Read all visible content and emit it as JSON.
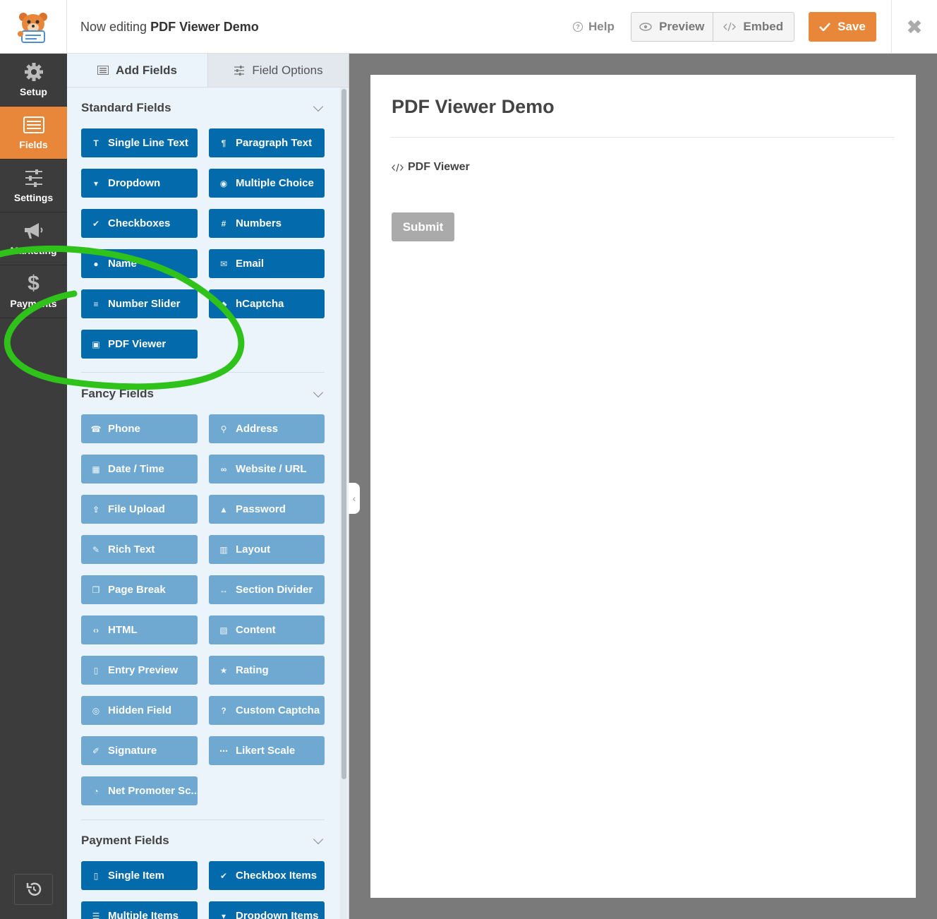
{
  "header": {
    "editing_prefix": "Now editing",
    "form_name": "PDF Viewer Demo",
    "help_label": "Help",
    "preview_label": "Preview",
    "embed_label": "Embed",
    "save_label": "Save",
    "accent_color": "#e8873a"
  },
  "sidebar": {
    "items": [
      {
        "label": "Setup",
        "icon": "gear-icon"
      },
      {
        "label": "Fields",
        "icon": "fields-list-icon",
        "active": true
      },
      {
        "label": "Settings",
        "icon": "sliders-icon"
      },
      {
        "label": "Marketing",
        "icon": "megaphone-icon"
      },
      {
        "label": "Payments",
        "icon": "dollar-icon"
      }
    ],
    "revisions_icon": "history-icon"
  },
  "panel": {
    "tabs": [
      {
        "label": "Add Fields",
        "icon": "list-icon",
        "active": true
      },
      {
        "label": "Field Options",
        "icon": "sliders-icon",
        "active": false
      }
    ],
    "standard": {
      "title": "Standard Fields",
      "fields": [
        {
          "label": "Single Line Text",
          "icon": "text-icon"
        },
        {
          "label": "Paragraph Text",
          "icon": "paragraph-icon"
        },
        {
          "label": "Dropdown",
          "icon": "dropdown-icon"
        },
        {
          "label": "Multiple Choice",
          "icon": "radio-icon"
        },
        {
          "label": "Checkboxes",
          "icon": "checkbox-icon"
        },
        {
          "label": "Numbers",
          "icon": "hash-icon"
        },
        {
          "label": "Name",
          "icon": "user-icon"
        },
        {
          "label": "Email",
          "icon": "envelope-icon"
        },
        {
          "label": "Number Slider",
          "icon": "slider-icon"
        },
        {
          "label": "hCaptcha",
          "icon": "hcaptcha-icon"
        },
        {
          "label": "PDF Viewer",
          "icon": "pdf-icon"
        }
      ]
    },
    "fancy": {
      "title": "Fancy Fields",
      "fields": [
        {
          "label": "Phone",
          "icon": "phone-icon"
        },
        {
          "label": "Address",
          "icon": "map-pin-icon"
        },
        {
          "label": "Date / Time",
          "icon": "calendar-icon"
        },
        {
          "label": "Website / URL",
          "icon": "link-icon"
        },
        {
          "label": "File Upload",
          "icon": "upload-icon"
        },
        {
          "label": "Password",
          "icon": "lock-icon"
        },
        {
          "label": "Rich Text",
          "icon": "edit-icon"
        },
        {
          "label": "Layout",
          "icon": "columns-icon"
        },
        {
          "label": "Page Break",
          "icon": "copy-icon"
        },
        {
          "label": "Section Divider",
          "icon": "arrows-h-icon"
        },
        {
          "label": "HTML",
          "icon": "code-icon"
        },
        {
          "label": "Content",
          "icon": "image-icon"
        },
        {
          "label": "Entry Preview",
          "icon": "file-icon"
        },
        {
          "label": "Rating",
          "icon": "star-icon"
        },
        {
          "label": "Hidden Field",
          "icon": "eye-slash-icon"
        },
        {
          "label": "Custom Captcha",
          "icon": "question-icon"
        },
        {
          "label": "Signature",
          "icon": "pencil-icon"
        },
        {
          "label": "Likert Scale",
          "icon": "dots-icon"
        },
        {
          "label": "Net Promoter Sc...",
          "icon": "gauge-icon"
        }
      ]
    },
    "payment": {
      "title": "Payment Fields",
      "fields": [
        {
          "label": "Single Item",
          "icon": "file-icon"
        },
        {
          "label": "Checkbox Items",
          "icon": "checkbox-icon"
        },
        {
          "label": "Multiple Items",
          "icon": "list-icon"
        },
        {
          "label": "Dropdown Items",
          "icon": "dropdown-icon"
        }
      ]
    }
  },
  "preview": {
    "form_title": "PDF Viewer Demo",
    "field_label": "PDF Viewer",
    "submit_label": "Submit"
  }
}
